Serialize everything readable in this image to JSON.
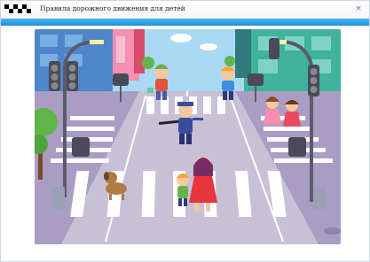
{
  "window": {
    "title": "Правила дорожного движения для детей",
    "close_glyph": "×",
    "accent_color": "#2a9fe4"
  },
  "scene": {
    "description_icon": "road-crossing-illustration",
    "colors": {
      "road": "#c8c0d6",
      "sidewalk": "#a99dc4",
      "sky": "#a9d9f3",
      "building_left": "#4f86c9",
      "building_right": "#3fb39b"
    }
  }
}
